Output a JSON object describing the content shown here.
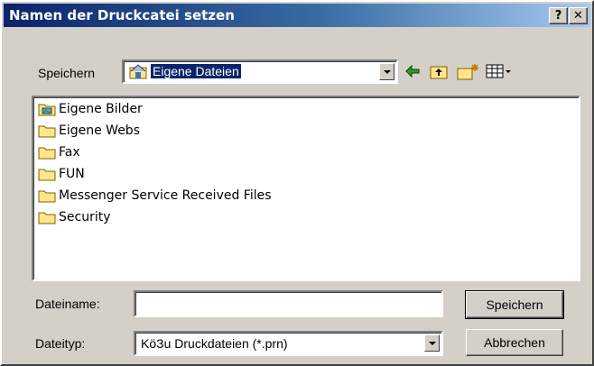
{
  "window": {
    "title": "Namen der Druckcatei setzen",
    "help_label": "?",
    "close_label": "✕"
  },
  "save_in": {
    "label": "Speichern",
    "value": "Eigene Dateien"
  },
  "toolbar": {
    "back_icon": "back-arrow-icon",
    "up_icon": "up-folder-icon",
    "new_folder_icon": "new-folder-icon",
    "view_icon": "view-menu-icon"
  },
  "files": [
    {
      "name": "Eigene Bilder",
      "icon": "pictures-folder-icon"
    },
    {
      "name": "Eigene Webs",
      "icon": "folder-icon"
    },
    {
      "name": "Fax",
      "icon": "folder-icon"
    },
    {
      "name": "FUN",
      "icon": "folder-icon"
    },
    {
      "name": "Messenger Service Received Files",
      "icon": "folder-icon"
    },
    {
      "name": "Security",
      "icon": "folder-icon"
    }
  ],
  "filename": {
    "label": "Dateiname:",
    "value": ""
  },
  "filetype": {
    "label": "Dateityp:",
    "value": "KöЗu Druckdateien (*.prn)"
  },
  "buttons": {
    "save": "Speichern",
    "cancel": "Abbrechen"
  },
  "colors": {
    "title_start": "#0a246a",
    "title_end": "#a6caf0",
    "face": "#d4d0c8",
    "folder": "#ffe68a"
  }
}
